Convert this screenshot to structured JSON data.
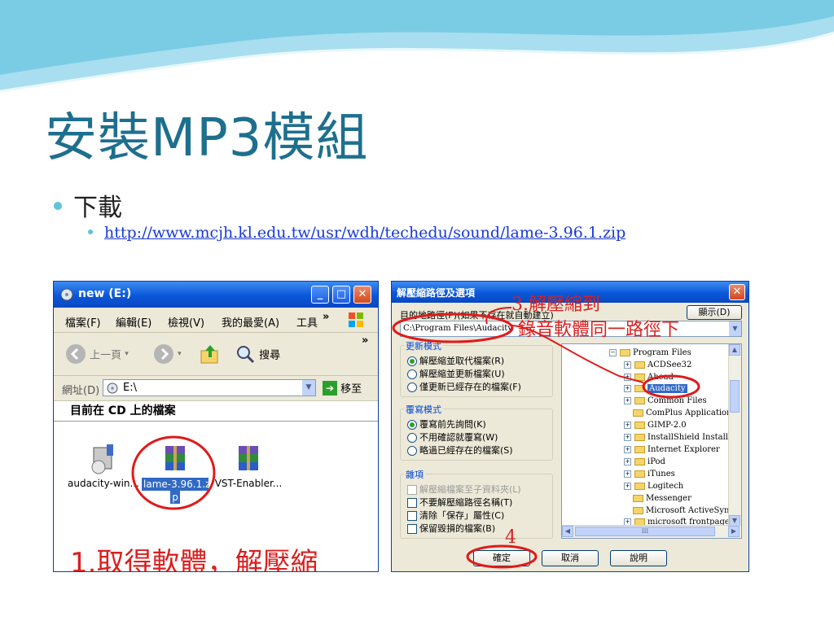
{
  "slide": {
    "title": "安裝MP3模組",
    "bullet1": "下載",
    "bullet2_link": "http://www.mcjh.kl.edu.tw/usr/wdh/techedu/sound/lame-3.96.1.zip"
  },
  "explorer": {
    "title": "new (E:)",
    "menu": [
      "檔案(F)",
      "編輯(E)",
      "檢視(V)",
      "我的最愛(A)",
      "工具"
    ],
    "menu_more": "»",
    "back_label": "上一頁",
    "search_label": "搜尋",
    "address_label": "網址(D)",
    "address_value": "E:\\",
    "go_label": "移至",
    "cd_label": "目前在 CD 上的檔案",
    "files": [
      {
        "name": "audacity-win..."
      },
      {
        "name": "lame-3.96.1.zi",
        "name2": "p"
      },
      {
        "name": "VST-Enabler..."
      }
    ],
    "annotation": "1.取得軟體，解壓縮"
  },
  "extract": {
    "title": "解壓縮路徑及選項",
    "dest_label": "目的地路徑(P)(如果不存在就自動建立)",
    "dest_value": "C:\\Program Files\\Audacity",
    "show_button": "顯示(D)",
    "update_group": "更新模式",
    "update_options": [
      "解壓縮並取代檔案(R)",
      "解壓縮並更新檔案(U)",
      "僅更新已經存在的檔案(F)"
    ],
    "overwrite_group": "覆寫模式",
    "overwrite_options": [
      "覆寫前先詢問(K)",
      "不用確認就覆寫(W)",
      "略過已經存在的檔案(S)"
    ],
    "misc_group": "雜項",
    "misc_options": [
      "解壓縮檔案至子資料夾(L)",
      "不要解壓縮路徑名稱(T)",
      "清除「保存」屬性(C)",
      "保留毀損的檔案(B)"
    ],
    "tree": [
      {
        "label": "Program Files",
        "pm": "−"
      },
      {
        "label": "ACDSee32",
        "pm": "+"
      },
      {
        "label": "Ahead",
        "pm": "+"
      },
      {
        "label": "Audacity",
        "pm": "+"
      },
      {
        "label": "Common Files",
        "pm": "+"
      },
      {
        "label": "ComPlus Applications",
        "pm": ""
      },
      {
        "label": "GIMP-2.0",
        "pm": "+"
      },
      {
        "label": "InstallShield Installation",
        "pm": "+"
      },
      {
        "label": "Internet Explorer",
        "pm": "+"
      },
      {
        "label": "iPod",
        "pm": "+"
      },
      {
        "label": "iTunes",
        "pm": "+"
      },
      {
        "label": "Logitech",
        "pm": "+"
      },
      {
        "label": "Messenger",
        "pm": ""
      },
      {
        "label": "Microsoft ActiveSync",
        "pm": ""
      },
      {
        "label": "microsoft frontpage",
        "pm": "+"
      }
    ],
    "hscroll_mark": "III",
    "ok_button": "確定",
    "cancel_button": "取消",
    "help_button": "說明",
    "annotation3_line1": "3.解壓縮到",
    "annotation3_line2": "錄音軟體同一路徑下",
    "annotation4": "4"
  },
  "colors": {
    "title": "#1e6f8e",
    "accent": "#5fc3dc",
    "annot": "#d92020",
    "xp_blue": "#0a57d9"
  }
}
